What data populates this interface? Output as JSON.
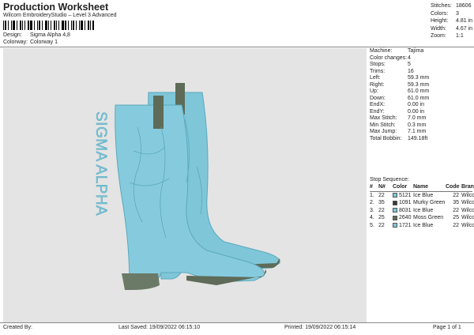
{
  "header": {
    "title": "Production Worksheet",
    "subtitle": "Wilcom EmbroideryStudio – Level 3 Advanced"
  },
  "design": {
    "design_label": "Design:",
    "design_value": "Sigma Alpha 4,8",
    "colorway_label": "Colorway:",
    "colorway_value": "Colorway 1"
  },
  "top_stats": [
    {
      "label": "Stitches:",
      "value": "18606"
    },
    {
      "label": "Colors:",
      "value": "3"
    },
    {
      "label": "Height:",
      "value": "4.81 in"
    },
    {
      "label": "Width:",
      "value": "4.67 in"
    },
    {
      "label": "Zoom:",
      "value": "1:1"
    }
  ],
  "machine_info": [
    {
      "label": "Machine:",
      "value": "Tajima"
    },
    {
      "label": "Color changes:",
      "value": "4"
    },
    {
      "label": "Stops:",
      "value": "5"
    },
    {
      "label": "Trims:",
      "value": "16"
    },
    {
      "label": "Left:",
      "value": "59.3 mm"
    },
    {
      "label": "Right:",
      "value": "59.3 mm"
    },
    {
      "label": "Up:",
      "value": "61.0 mm"
    },
    {
      "label": "Down:",
      "value": "61.0 mm"
    },
    {
      "label": "EndX:",
      "value": "0.00 in"
    },
    {
      "label": "EndY:",
      "value": "0.00 in"
    },
    {
      "label": "Max Stitch:",
      "value": "7.0 mm"
    },
    {
      "label": "Min Stitch:",
      "value": "0.3 mm"
    },
    {
      "label": "Max Jump:",
      "value": "7.1 mm"
    },
    {
      "label": "Total Bobbin:",
      "value": "149.18ft"
    }
  ],
  "stop_sequence": {
    "heading": "Stop Sequence:",
    "columns": [
      "#",
      "N#",
      "Color",
      "Name",
      "Code",
      "Brand"
    ],
    "rows": [
      {
        "idx": "1.",
        "n": "22",
        "color_hex": "#7fc6d9",
        "code_num": "5121",
        "name": "Ice Blue",
        "code": "22",
        "brand": "Wilcom"
      },
      {
        "idx": "2.",
        "n": "35",
        "color_hex": "#3a3a2e",
        "code_num": "1091",
        "name": "Murky Green",
        "code": "35",
        "brand": "Wilcom"
      },
      {
        "idx": "3.",
        "n": "22",
        "color_hex": "#7fc6d9",
        "code_num": "8031",
        "name": "Ice Blue",
        "code": "22",
        "brand": "Wilcom"
      },
      {
        "idx": "4.",
        "n": "25",
        "color_hex": "#5e6b58",
        "code_num": "2640",
        "name": "Moss Green",
        "code": "25",
        "brand": "Wilcom"
      },
      {
        "idx": "5.",
        "n": "22",
        "color_hex": "#7fc6d9",
        "code_num": "1721",
        "name": "Ice Blue",
        "code": "22",
        "brand": "Wilcom"
      }
    ]
  },
  "design_text": "SIGMA ALPHA",
  "footer": {
    "created_by": "Created By:",
    "last_saved": "Last Saved: 19/09/2022 06:15:10",
    "printed": "Printed: 19/09/2022 06:15:14",
    "page": "Page 1 of 1"
  },
  "colors": {
    "boot": "#7fc6d9",
    "boot_shadow": "#5aa9bd",
    "heel": "#6b7a66",
    "pull_tab": "#5e6b58",
    "canvas_bg": "#e4e4e4"
  }
}
